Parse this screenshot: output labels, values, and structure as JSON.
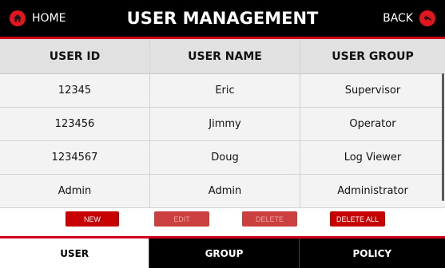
{
  "header": {
    "home_label": "HOME",
    "title": "USER MANAGEMENT",
    "back_label": "BACK"
  },
  "table": {
    "columns": [
      "USER ID",
      "USER NAME",
      "USER GROUP"
    ],
    "rows": [
      {
        "id": "12345",
        "name": "Eric",
        "group": "Supervisor"
      },
      {
        "id": "123456",
        "name": "Jimmy",
        "group": "Operator"
      },
      {
        "id": "1234567",
        "name": "Doug",
        "group": "Log Viewer"
      },
      {
        "id": "Admin",
        "name": "Admin",
        "group": "Administrator"
      }
    ]
  },
  "actions": {
    "new": "NEW",
    "edit": "EDIT",
    "delete": "DELETE",
    "delete_all": "DELETE ALL"
  },
  "tabs": {
    "user": "USER",
    "group": "GROUP",
    "policy": "POLICY"
  },
  "colors": {
    "accent": "#d0021b",
    "button": "#c70000",
    "header_bg": "#000000"
  },
  "icons": {
    "home": "home-icon",
    "back": "back-arrow-icon"
  }
}
